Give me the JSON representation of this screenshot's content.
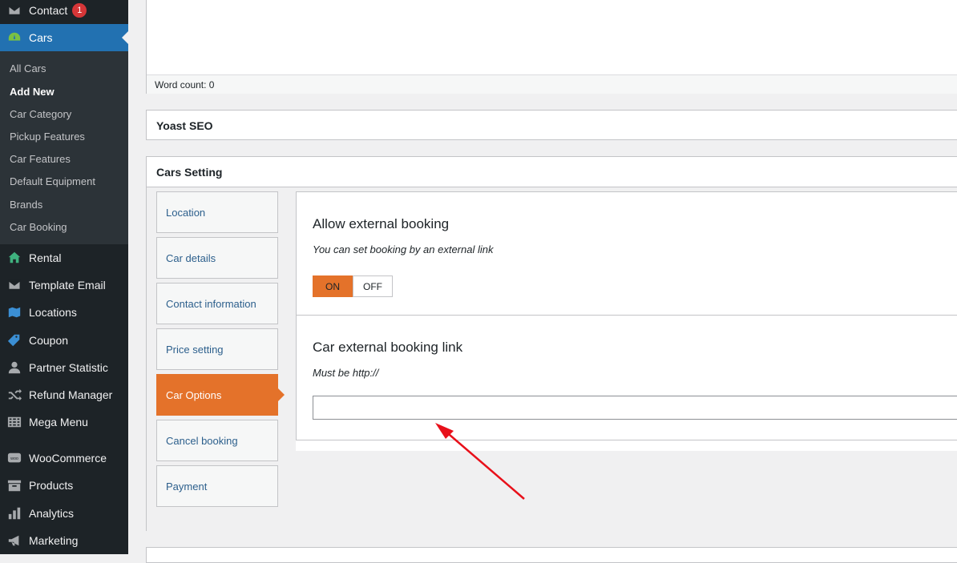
{
  "sidebar": {
    "contact": {
      "label": "Contact",
      "badge": "1",
      "icon": "envelope-icon"
    },
    "cars": {
      "label": "Cars",
      "icon": "dashboard-icon"
    },
    "submenu": [
      {
        "label": "All Cars"
      },
      {
        "label": "Add New"
      },
      {
        "label": "Car Category"
      },
      {
        "label": "Pickup Features"
      },
      {
        "label": "Car Features"
      },
      {
        "label": "Default Equipment"
      },
      {
        "label": "Brands"
      },
      {
        "label": "Car Booking"
      }
    ],
    "items": [
      {
        "label": "Rental",
        "icon": "home-icon"
      },
      {
        "label": "Template Email",
        "icon": "envelope-icon"
      },
      {
        "label": "Locations",
        "icon": "map-icon"
      },
      {
        "label": "Coupon",
        "icon": "tag-icon"
      },
      {
        "label": "Partner Statistic",
        "icon": "person-icon"
      },
      {
        "label": "Refund Manager",
        "icon": "shuffle-icon"
      },
      {
        "label": "Mega Menu",
        "icon": "grid-icon"
      },
      {
        "label": "WooCommerce",
        "icon": "woo-icon"
      },
      {
        "label": "Products",
        "icon": "archive-icon"
      },
      {
        "label": "Analytics",
        "icon": "bar-chart-icon"
      },
      {
        "label": "Marketing",
        "icon": "megaphone-icon"
      }
    ]
  },
  "editor": {
    "word_count": "Word count: 0"
  },
  "yoast": {
    "title": "Yoast SEO"
  },
  "cars_setting": {
    "title": "Cars Setting",
    "tabs": [
      {
        "label": "Location"
      },
      {
        "label": "Car details"
      },
      {
        "label": "Contact information"
      },
      {
        "label": "Price setting"
      },
      {
        "label": "Car Options"
      },
      {
        "label": "Cancel booking"
      },
      {
        "label": "Payment"
      }
    ],
    "active_tab": "Car Options",
    "external_booking": {
      "title": "Allow external booking",
      "description": "You can set booking by an external link",
      "on_label": "ON",
      "off_label": "OFF",
      "state": "ON"
    },
    "external_link": {
      "title": "Car external booking link",
      "description": "Must be http://",
      "value": ""
    }
  },
  "colors": {
    "sidebar_bg": "#1d2327",
    "active_menu": "#2271b1",
    "accent_orange": "#e4722a",
    "annotation_arrow": "#e8101a"
  }
}
